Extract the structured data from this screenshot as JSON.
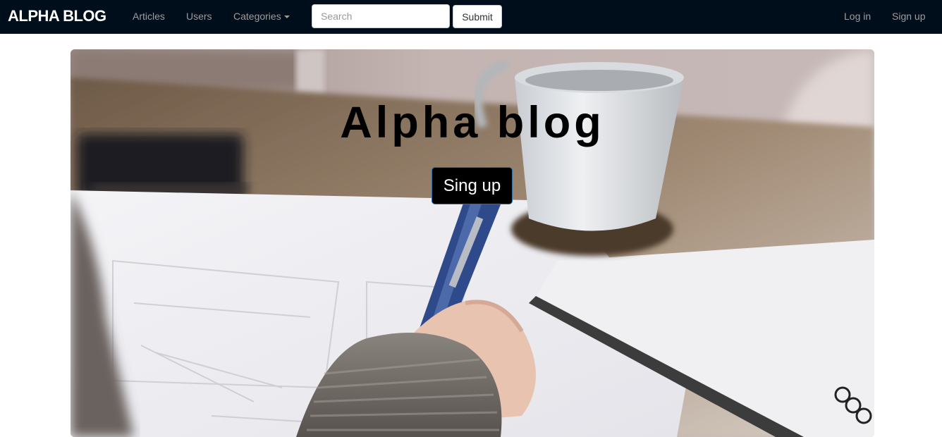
{
  "navbar": {
    "brand": "ALPHA BLOG",
    "links": {
      "articles": "Articles",
      "users": "Users",
      "categories": "Categories"
    },
    "search": {
      "placeholder": "Search",
      "value": "",
      "submit_label": "Submit"
    },
    "auth": {
      "login": "Log in",
      "signup": "Sign up"
    },
    "background_color": "#000d1a"
  },
  "hero": {
    "title": "Alpha blog",
    "button_label": "Sing up",
    "button_color": "#000000",
    "button_border_color": "#2e6da4"
  }
}
